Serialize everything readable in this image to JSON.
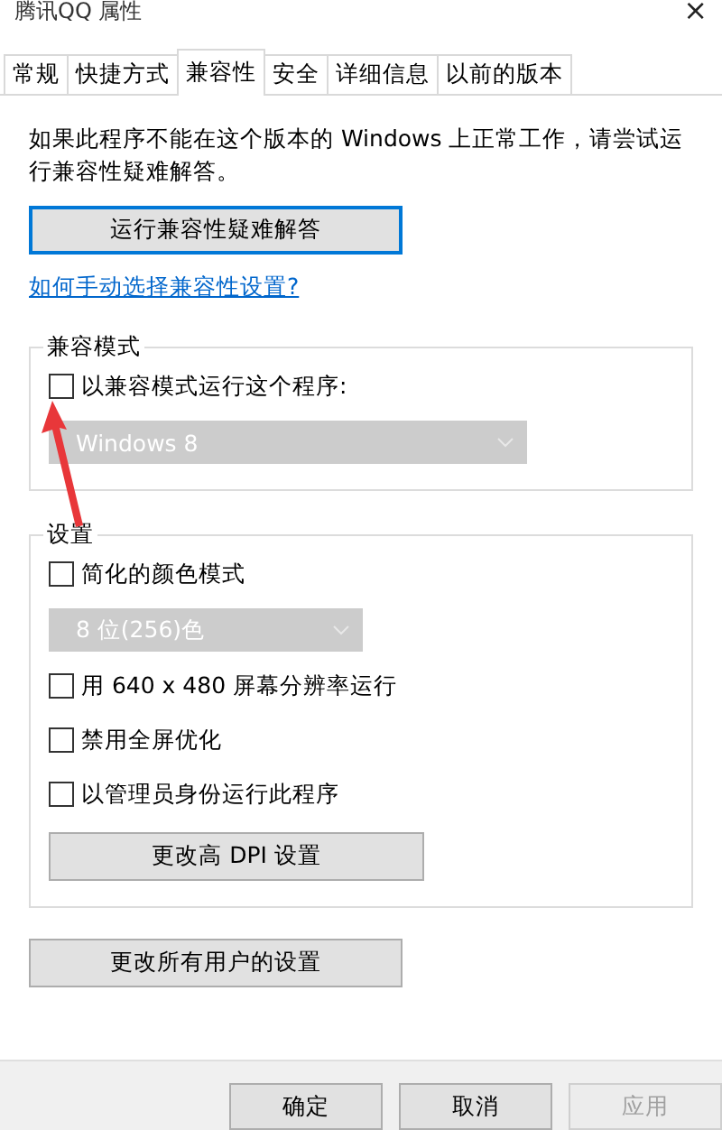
{
  "window": {
    "title": "腾讯QQ 属性",
    "close": "×"
  },
  "tabs": [
    {
      "label": "常规",
      "selected": false
    },
    {
      "label": "快捷方式",
      "selected": false
    },
    {
      "label": "兼容性",
      "selected": true
    },
    {
      "label": "安全",
      "selected": false
    },
    {
      "label": "详细信息",
      "selected": false
    },
    {
      "label": "以前的版本",
      "selected": false
    }
  ],
  "intro": "如果此程序不能在这个版本的 Windows 上正常工作，请尝试运行兼容性疑难解答。",
  "troubleshoot_button": {
    "label": "运行兼容性疑难解答",
    "focused": true
  },
  "help_link": "如何手动选择兼容性设置?",
  "groups": [
    {
      "title": "兼容模式",
      "items": [
        {
          "kind": "checkbox",
          "label": "以兼容模式运行这个程序:",
          "checked": false
        },
        {
          "kind": "dropdown",
          "value": "Windows 8",
          "disabled": true
        }
      ]
    },
    {
      "title": "设置",
      "items": [
        {
          "kind": "checkbox",
          "label": "简化的颜色模式",
          "checked": false
        },
        {
          "kind": "dropdown",
          "value": "8 位(256)色",
          "disabled": true
        },
        {
          "kind": "checkbox",
          "label": "用 640 x 480 屏幕分辨率运行",
          "checked": false
        },
        {
          "kind": "checkbox",
          "label": "禁用全屏优化",
          "checked": false
        },
        {
          "kind": "checkbox",
          "label": "以管理员身份运行此程序",
          "checked": false
        },
        {
          "kind": "button",
          "label": "更改高 DPI 设置"
        }
      ]
    }
  ],
  "all_users_button": {
    "label": "更改所有用户的设置"
  },
  "footer_buttons": [
    {
      "label": "确定",
      "disabled": false
    },
    {
      "label": "取消",
      "disabled": false
    },
    {
      "label": "应用",
      "disabled": true
    }
  ],
  "annotations": [
    {
      "kind": "arrow"
    }
  ]
}
